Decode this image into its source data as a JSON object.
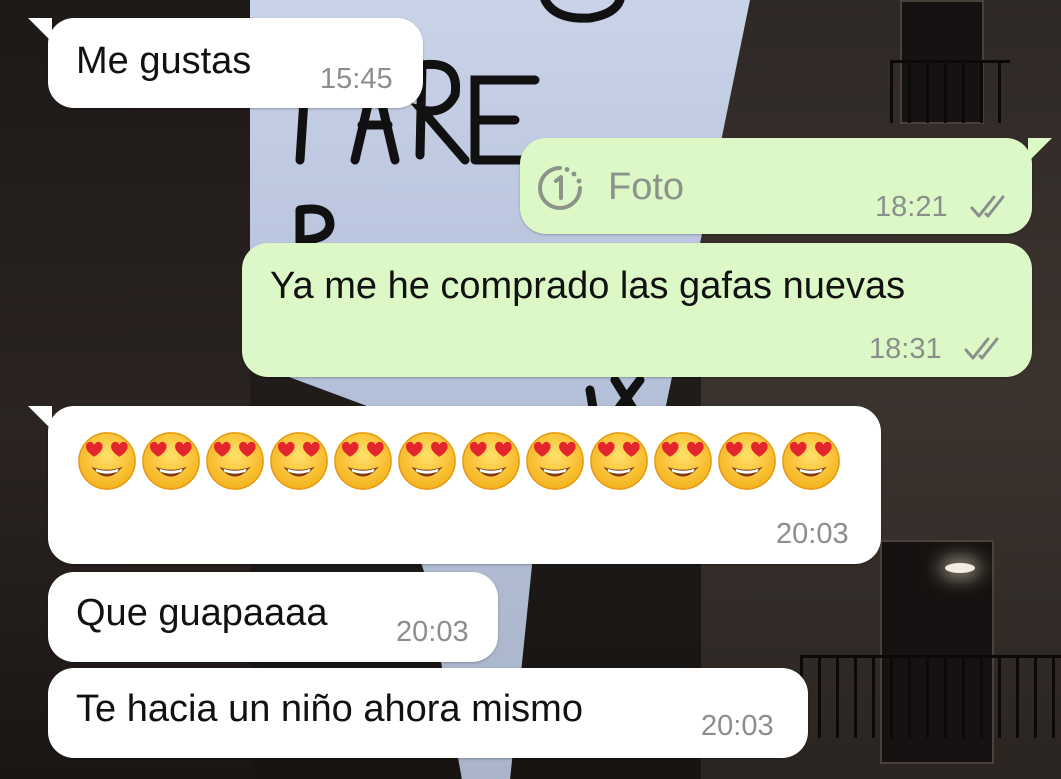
{
  "chat": {
    "messages": [
      {
        "id": "m1",
        "direction": "incoming",
        "text": "Me gustas",
        "time": "15:45"
      },
      {
        "id": "m2",
        "direction": "outgoing",
        "type": "photo",
        "text": "Foto",
        "time": "18:21",
        "status": "read",
        "view_once_icon": "view-once-1-icon"
      },
      {
        "id": "m3",
        "direction": "outgoing",
        "text": "Ya me he comprado las gafas nuevas",
        "time": "18:31",
        "status": "read"
      },
      {
        "id": "m4",
        "direction": "incoming",
        "type": "emoji",
        "emoji_count": 12,
        "emoji_name": "heart-eyes-emoji",
        "time": "20:03"
      },
      {
        "id": "m5",
        "direction": "incoming",
        "text": "Que guapaaaa",
        "time": "20:03"
      },
      {
        "id": "m6",
        "direction": "incoming",
        "text": "Te hacia un niño ahora mismo",
        "time": "20:03"
      }
    ]
  },
  "theme": {
    "incoming_bubble": "#ffffff",
    "outgoing_bubble": "#dcf8c6",
    "timestamp": "#8a8f8c",
    "read_ticks": "#8a8f8c"
  }
}
